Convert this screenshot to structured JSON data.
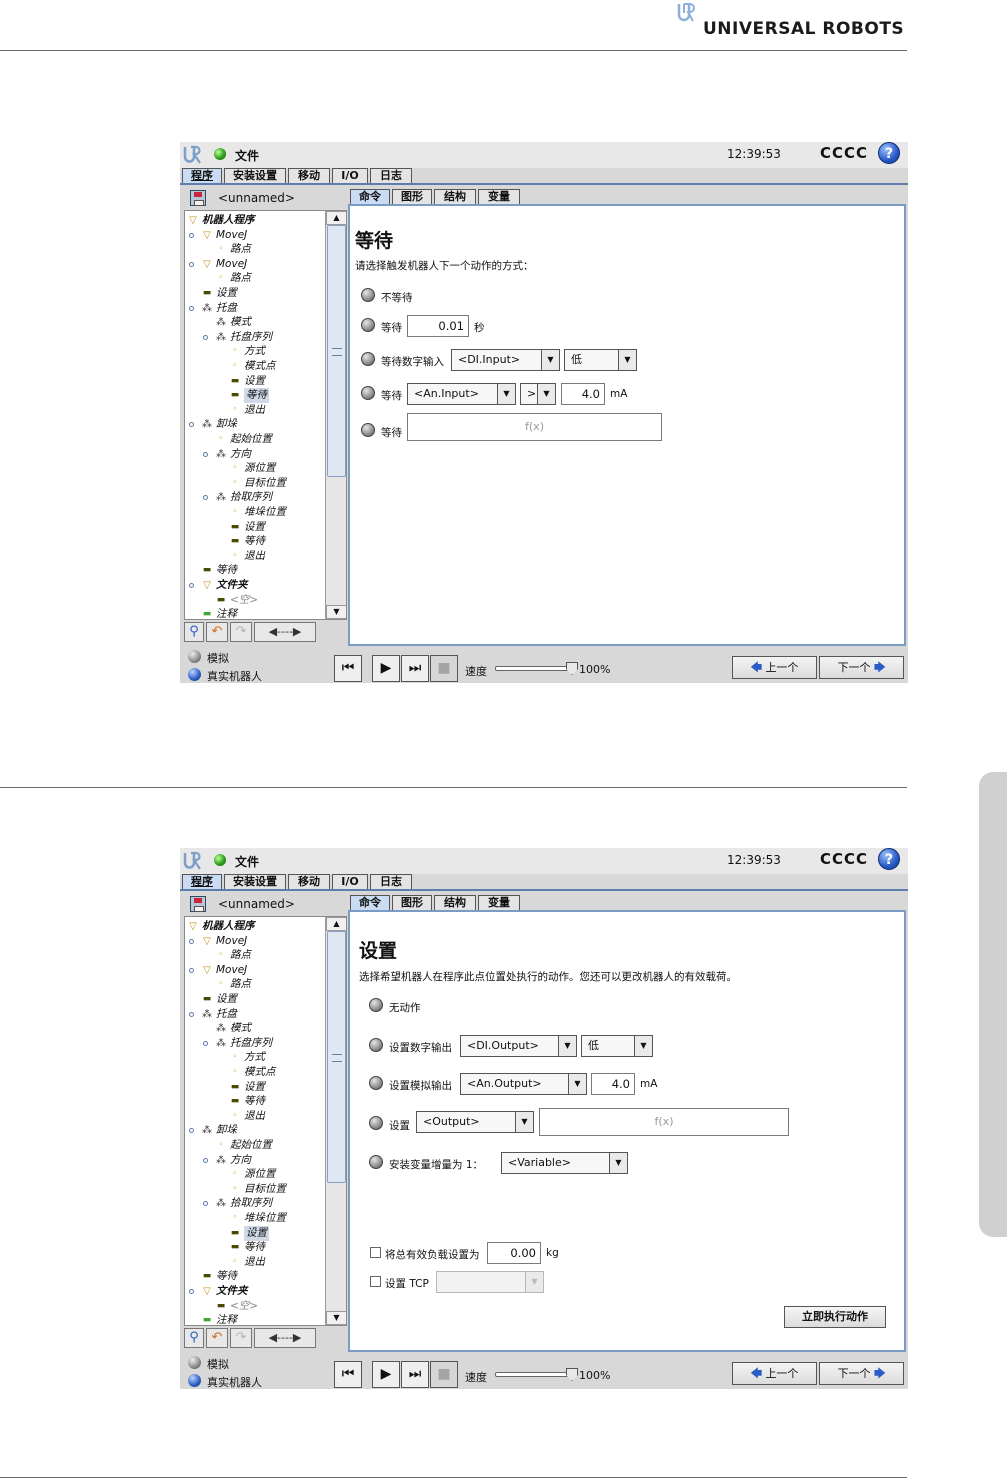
{
  "brand": "UNIVERSAL ROBOTS",
  "colors": {
    "accent_blue": "#5c7ea8",
    "panel_border": "#7a9bc4",
    "tab_active": "#c9dcf3",
    "status_green": "#2f9e1a"
  },
  "screens": [
    {
      "title_bar": {
        "file_menu": "文件",
        "clock": "12:39:53",
        "robot_name": "CCCC",
        "help_label": "?"
      },
      "main_tabs": [
        "程序",
        "安装设置",
        "移动",
        "I/O",
        "日志"
      ],
      "program_name": "<unnamed>",
      "tree": [
        {
          "label": "机器人程序",
          "icon": "triangle-icon",
          "style": "bold"
        },
        {
          "label": "MoveJ",
          "icon": "triangle-icon"
        },
        {
          "label": "路点",
          "icon": "waypoint-icon"
        },
        {
          "label": "MoveJ",
          "icon": "triangle-icon"
        },
        {
          "label": "路点",
          "icon": "waypoint-icon"
        },
        {
          "label": "设置",
          "icon": "bar-icon"
        },
        {
          "label": "托盘",
          "icon": "fork-icon"
        },
        {
          "label": "模式",
          "icon": "fork-icon"
        },
        {
          "label": "托盘序列",
          "icon": "fork-icon"
        },
        {
          "label": "方式",
          "icon": "waypoint-icon"
        },
        {
          "label": "模式点",
          "icon": "waypoint-icon"
        },
        {
          "label": "设置",
          "icon": "bar-icon"
        },
        {
          "label": "等待",
          "icon": "bar-icon"
        },
        {
          "label": "退出",
          "icon": "waypoint-icon"
        },
        {
          "label": "卸垛",
          "icon": "fork-icon"
        },
        {
          "label": "起始位置",
          "icon": "waypoint-icon"
        },
        {
          "label": "方向",
          "icon": "fork-icon"
        },
        {
          "label": "源位置",
          "icon": "waypoint-icon"
        },
        {
          "label": "目标位置",
          "icon": "waypoint-icon"
        },
        {
          "label": "拾取序列",
          "icon": "fork-icon"
        },
        {
          "label": "堆垛位置",
          "icon": "waypoint-icon"
        },
        {
          "label": "设置",
          "icon": "bar-icon"
        },
        {
          "label": "等待",
          "icon": "bar-icon"
        },
        {
          "label": "退出",
          "icon": "waypoint-icon"
        },
        {
          "label": "等待",
          "icon": "bar-icon"
        },
        {
          "label": "文件夹",
          "icon": "triangle-icon",
          "style": "bold"
        },
        {
          "label": "<空>",
          "icon": "bar-icon",
          "style": "grey"
        },
        {
          "label": "注释",
          "icon": "bar-icon"
        }
      ],
      "selected_node": 12,
      "tree_tools": {
        "back_label": "◀----▶"
      },
      "sub_tabs": [
        "命令",
        "图形",
        "结构",
        "变量"
      ],
      "wait_panel": {
        "title": "等待",
        "description": "请选择触发机器人下一个动作的方式：",
        "opt_no_wait": "不等待",
        "opt_wait": "等待",
        "wait_seconds": "0.01",
        "wait_unit": "秒",
        "opt_digital": "等待数字输入",
        "digital_input": "<DI.Input>",
        "digital_level": "低",
        "opt_analog": "等待",
        "analog_input": "<An.Input>",
        "analog_operator": ">",
        "analog_value": "4.0",
        "analog_unit": "mA",
        "opt_expr": "等待",
        "expr_placeholder": "f(x)"
      },
      "bottom": {
        "mode_sim": "模拟",
        "mode_real": "真实机器人",
        "speed_label": "速度",
        "speed_value": "100%",
        "speed_fraction": 1.0,
        "prev_label": "上一个",
        "next_label": "下一个"
      }
    },
    {
      "title_bar": {
        "file_menu": "文件",
        "clock": "12:39:53",
        "robot_name": "CCCC",
        "help_label": "?"
      },
      "main_tabs": [
        "程序",
        "安装设置",
        "移动",
        "I/O",
        "日志"
      ],
      "program_name": "<unnamed>",
      "tree": [
        {
          "label": "机器人程序",
          "icon": "triangle-icon",
          "style": "bold"
        },
        {
          "label": "MoveJ",
          "icon": "triangle-icon"
        },
        {
          "label": "路点",
          "icon": "waypoint-icon"
        },
        {
          "label": "MoveJ",
          "icon": "triangle-icon"
        },
        {
          "label": "路点",
          "icon": "waypoint-icon"
        },
        {
          "label": "设置",
          "icon": "bar-icon"
        },
        {
          "label": "托盘",
          "icon": "fork-icon"
        },
        {
          "label": "模式",
          "icon": "fork-icon"
        },
        {
          "label": "托盘序列",
          "icon": "fork-icon"
        },
        {
          "label": "方式",
          "icon": "waypoint-icon"
        },
        {
          "label": "模式点",
          "icon": "waypoint-icon"
        },
        {
          "label": "设置",
          "icon": "bar-icon"
        },
        {
          "label": "等待",
          "icon": "bar-icon"
        },
        {
          "label": "退出",
          "icon": "waypoint-icon"
        },
        {
          "label": "卸垛",
          "icon": "fork-icon"
        },
        {
          "label": "起始位置",
          "icon": "waypoint-icon"
        },
        {
          "label": "方向",
          "icon": "fork-icon"
        },
        {
          "label": "源位置",
          "icon": "waypoint-icon"
        },
        {
          "label": "目标位置",
          "icon": "waypoint-icon"
        },
        {
          "label": "拾取序列",
          "icon": "fork-icon"
        },
        {
          "label": "堆垛位置",
          "icon": "waypoint-icon"
        },
        {
          "label": "设置",
          "icon": "bar-icon"
        },
        {
          "label": "等待",
          "icon": "bar-icon"
        },
        {
          "label": "退出",
          "icon": "waypoint-icon"
        },
        {
          "label": "等待",
          "icon": "bar-icon"
        },
        {
          "label": "文件夹",
          "icon": "triangle-icon",
          "style": "bold"
        },
        {
          "label": "<空>",
          "icon": "bar-icon",
          "style": "grey"
        },
        {
          "label": "注释",
          "icon": "bar-icon"
        }
      ],
      "selected_node": 21,
      "tree_tools": {
        "back_label": "◀----▶"
      },
      "sub_tabs": [
        "命令",
        "图形",
        "结构",
        "变量"
      ],
      "set_panel": {
        "title": "设置",
        "description": "选择希望机器人在程序此点位置处执行的动作。您还可以更改机器人的有效载荷。",
        "opt_no_action": "无动作",
        "opt_digital": "设置数字输出",
        "digital_output": "<DI.Output>",
        "digital_level": "低",
        "opt_analog": "设置模拟输出",
        "analog_output": "<An.Output>",
        "analog_value": "4.0",
        "analog_unit": "mA",
        "opt_expr": "设置",
        "expr_output": "<Output>",
        "expr_placeholder": "f(x)",
        "opt_increment": "安装变量增量为 1：",
        "increment_variable": "<Variable>",
        "payload_label": "将总有效负载设置为",
        "payload_value": "0.00",
        "payload_unit": "kg",
        "tcp_label": "设置 TCP",
        "execute_label": "立即执行动作"
      },
      "bottom": {
        "mode_sim": "模拟",
        "mode_real": "真实机器人",
        "speed_label": "速度",
        "speed_value": "100%",
        "speed_fraction": 1.0,
        "prev_label": "上一个",
        "next_label": "下一个"
      }
    }
  ]
}
